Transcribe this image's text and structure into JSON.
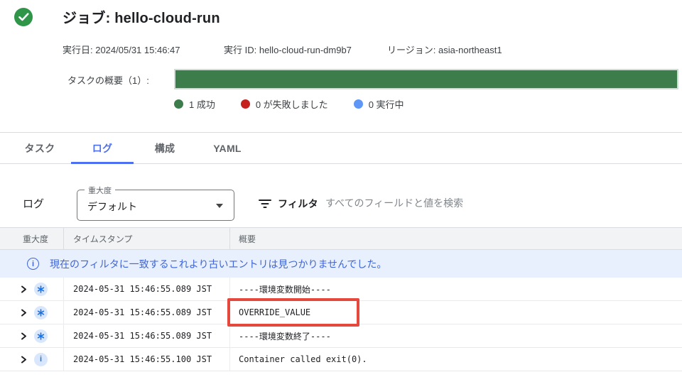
{
  "header": {
    "title": "ジョブ: hello-cloud-run",
    "meta": {
      "run_date": "実行日: 2024/05/31 15:46:47",
      "run_id": "実行 ID: hello-cloud-run-dm9b7",
      "region": "リージョン: asia-northeast1"
    },
    "task_summary": {
      "label": "タスクの概要（1）:",
      "bar_color": "#3C7D4B",
      "legend": [
        {
          "label": "1 成功",
          "color": "#3C7D4B"
        },
        {
          "label": "0 が失敗しました",
          "color": "#C5221F"
        },
        {
          "label": "0 実行中",
          "color": "#5E97F6"
        }
      ]
    }
  },
  "tabs": [
    {
      "label": "タスク",
      "active": false
    },
    {
      "label": "ログ",
      "active": true
    },
    {
      "label": "構成",
      "active": false
    },
    {
      "label": "YAML",
      "active": false
    }
  ],
  "log_controls": {
    "section_label": "ログ",
    "severity_field": {
      "label": "重大度",
      "value": "デフォルト"
    },
    "filter_label": "フィルタ",
    "search_placeholder": "すべてのフィールドと値を検索"
  },
  "log_table": {
    "columns": [
      "重大度",
      "タイムスタンプ",
      "概要"
    ],
    "notice": "現在のフィルタに一致するこれより古いエントリは見つかりませんでした。",
    "rows": [
      {
        "severity": "default",
        "timestamp": "2024-05-31 15:46:55.089 JST",
        "summary": "----環境変数開始----"
      },
      {
        "severity": "default",
        "timestamp": "2024-05-31 15:46:55.089 JST",
        "summary": "OVERRIDE_VALUE",
        "highlighted": true
      },
      {
        "severity": "default",
        "timestamp": "2024-05-31 15:46:55.089 JST",
        "summary": "----環境変数終了----"
      },
      {
        "severity": "info",
        "timestamp": "2024-05-31 15:46:55.100 JST",
        "summary": "Container called exit(0)."
      }
    ]
  },
  "icons": {
    "status": "check-circle-icon",
    "severity_default": "asterisk-icon",
    "severity_info": "info-icon",
    "notice": "info-outline-icon",
    "filter": "filter-list-icon",
    "dropdown": "arrow-drop-down-icon",
    "expand": "chevron-right-icon"
  },
  "colors": {
    "accent_blue": "#4D6FF2",
    "annotation_red": "#E5483C",
    "notice_bg": "#E8F0FE",
    "notice_text": "#3F65D6",
    "success_green": "#3C7D4B",
    "failed_red": "#C5221F",
    "running_blue": "#5E97F6"
  }
}
